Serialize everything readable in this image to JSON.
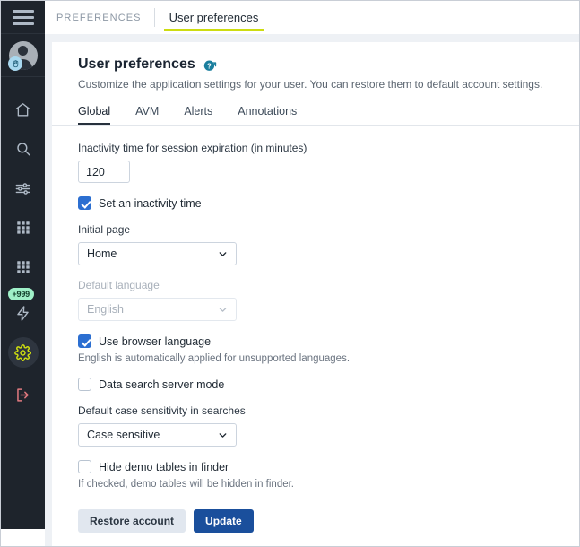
{
  "sidebar": {
    "menu_label": "menu",
    "avatar_label": "user avatar",
    "items": [
      {
        "label": "Home",
        "icon": "home-icon"
      },
      {
        "label": "Search",
        "icon": "search-icon"
      },
      {
        "label": "Filters",
        "icon": "sliders-icon"
      },
      {
        "label": "Apps",
        "icon": "grid-icon"
      },
      {
        "label": "Modules",
        "icon": "grid-icon"
      },
      {
        "label": "Alerts",
        "icon": "lightning-icon",
        "badge": "+999"
      },
      {
        "label": "Settings",
        "icon": "gear-icon",
        "active": true
      },
      {
        "label": "Log out",
        "icon": "logout-icon"
      }
    ]
  },
  "topbar": {
    "breadcrumb": "PREFERENCES",
    "tab": "User preferences"
  },
  "page": {
    "title": "User preferences",
    "help_icon": "help-external-link-icon",
    "subtitle": "Customize the application settings for your user. You can restore them to default account settings."
  },
  "tabs": [
    {
      "label": "Global",
      "active": true
    },
    {
      "label": "AVM",
      "active": false
    },
    {
      "label": "Alerts",
      "active": false
    },
    {
      "label": "Annotations",
      "active": false
    }
  ],
  "form": {
    "inactivity_label": "Inactivity time for session expiration (in minutes)",
    "inactivity_value": "120",
    "set_inactivity_label": "Set an inactivity time",
    "set_inactivity_checked": true,
    "initial_page_label": "Initial page",
    "initial_page_value": "Home",
    "default_language_label": "Default language",
    "default_language_value": "English",
    "default_language_disabled": true,
    "use_browser_language_label": "Use browser language",
    "use_browser_language_checked": true,
    "use_browser_language_hint": "English is automatically applied for unsupported languages.",
    "data_search_label": "Data search server mode",
    "data_search_checked": false,
    "case_sensitivity_label": "Default case sensitivity in searches",
    "case_sensitivity_value": "Case sensitive",
    "hide_demo_label": "Hide demo tables in finder",
    "hide_demo_checked": false,
    "hide_demo_hint": "If checked, demo tables will be hidden in finder."
  },
  "buttons": {
    "restore": "Restore account",
    "update": "Update"
  },
  "colors": {
    "sidebar_bg": "#1e242c",
    "accent_yellow": "#cddc10",
    "primary_blue": "#1a4f9c",
    "checkbox_blue": "#2c6fd1",
    "badge_green": "#9ff0c8",
    "logout_red": "#e0797f",
    "help_teal": "#1b7f9e"
  }
}
